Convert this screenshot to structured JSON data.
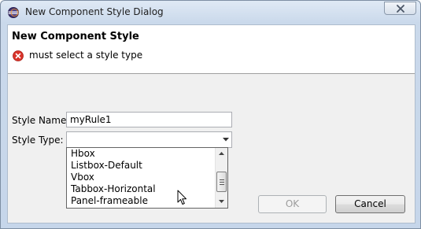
{
  "window": {
    "title": "New Component Style Dialog",
    "app_icon": "eclipse-icon",
    "close_icon": "close-icon"
  },
  "header": {
    "title": "New Component Style",
    "error_icon": "error-icon",
    "error_message": "must select a style type"
  },
  "form": {
    "style_name_label": "Style Name:",
    "style_name_value": "myRule1",
    "style_type_label": "Style Type:",
    "style_type_value": ""
  },
  "dropdown": {
    "items": [
      "Hbox",
      "Listbox-Default",
      "Vbox",
      "Tabbox-Horizontal",
      "Panel-frameable"
    ]
  },
  "buttons": {
    "ok_label": "OK",
    "cancel_label": "Cancel"
  },
  "colors": {
    "error_red": "#d9342b",
    "title_gradient_top": "#dfe9f5"
  }
}
